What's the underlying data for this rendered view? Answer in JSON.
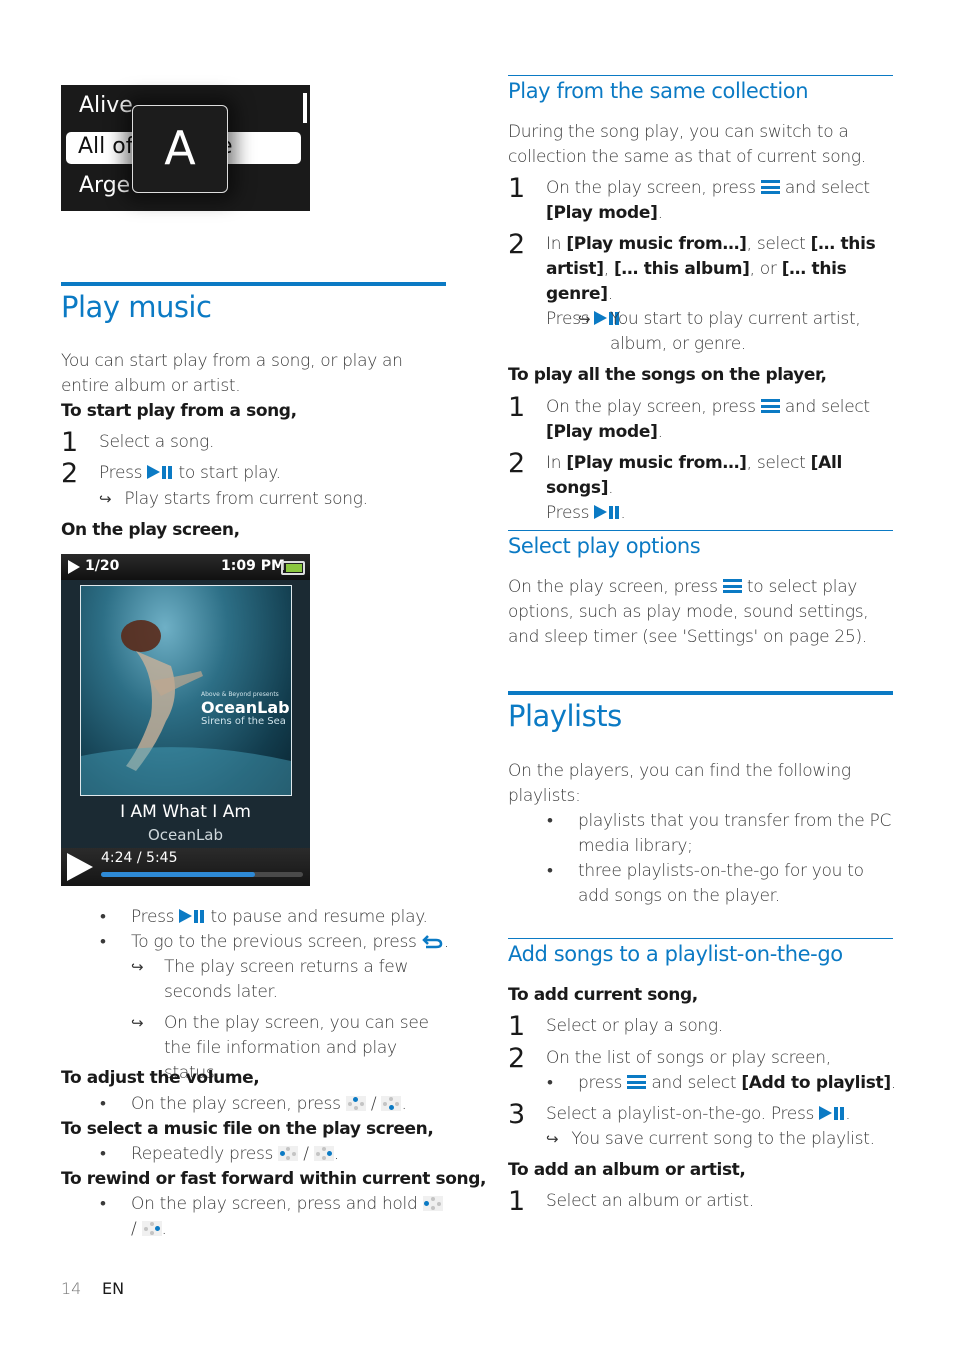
{
  "page": {
    "number": "14",
    "lang": "EN"
  },
  "colors": {
    "accent": "#0b7ac4",
    "text": "#3a3a3a",
    "heading_text": "#1a1a1a"
  },
  "list_screen": {
    "rows": [
      "Alive",
      "All of",
      "Argentina"
    ],
    "selected_row_visible": "All of",
    "selected_row_tail": "e",
    "row3_visible": "Arge",
    "letter_popup": "A"
  },
  "play_screen": {
    "track_position": "1/20",
    "time": "1:09 PM",
    "album_presenter": "Above & Beyond presents",
    "album_artist_logo": "OceanLab",
    "album_title": "Sirens of the Sea",
    "song_title": "I AM What I Am",
    "artist": "OceanLab",
    "elapsed_total": "4:24 / 5:45",
    "progress_fraction": 0.76,
    "battery_fraction": 0.9
  },
  "play_music": {
    "title": "Play music",
    "intro": "You can start play from a song, or play an entire album or artist.",
    "start_from_song_lead": "To start play from a song,",
    "steps": [
      {
        "num": "1",
        "text": "Select a song."
      },
      {
        "num": "2",
        "pre": "Press",
        "post": "to start play.",
        "result": "Play starts from current song."
      }
    ],
    "on_play_screen_lead": "On the play screen,",
    "bullets": [
      {
        "pre": "Press",
        "post": "to pause and resume play."
      },
      {
        "pre": "To go to the previous screen, press",
        "post": "."
      }
    ],
    "results": [
      "The play screen returns a few seconds later.",
      "On the play screen, you can see the file information and play status."
    ],
    "volume_lead": "To adjust the volume,",
    "volume_bullet": {
      "pre": "On the play screen, press",
      "sep": "/",
      "post": "."
    },
    "select_file_lead": "To select a music file on the play screen,",
    "select_file_bullet": {
      "pre": "Repeatedly press",
      "sep": "/",
      "post": "."
    },
    "rewind_lead": "To rewind or fast forward within current song,",
    "rewind_bullet": {
      "pre": "On the play screen, press and hold",
      "sep": "/",
      "post": "."
    }
  },
  "same_collection": {
    "title": "Play from the same collection",
    "intro": "During the song play, you can switch to a collection the same as that of current song.",
    "step1": {
      "num": "1",
      "pre": "On the play screen, press",
      "mid": "and select",
      "bold": "[Play mode]",
      "post": "."
    },
    "step2": {
      "num": "2",
      "in": "In",
      "bold1": "[Play music from…]",
      "select": ", select",
      "bold2": "[… this artist]",
      "bold3": "[… this album]",
      "or": ", or",
      "bold4": "[… this genre]",
      "press": "Press",
      "result": "You start to play current artist, album, or genre."
    },
    "all_songs_lead": "To play all the songs on the player,",
    "all_step1": {
      "num": "1",
      "pre": "On the play screen, press",
      "mid": "and select",
      "bold": "[Play mode]",
      "post": "."
    },
    "all_step2": {
      "num": "2",
      "in": "In",
      "bold1": "[Play music from…]",
      "select": ", select",
      "bold2": "[All songs]",
      "post": ".",
      "press": "Press"
    }
  },
  "play_options": {
    "title": "Select play options",
    "pre": "On the play screen, press",
    "post": "to select play options, such as play mode, sound settings, and sleep timer (see 'Settings' on page 25)."
  },
  "playlists": {
    "title": "Playlists",
    "intro": "On the players, you can find the following playlists:",
    "bullets": [
      "playlists that you transfer from the PC media library;",
      "three playlists-on-the-go for you to add songs on the player."
    ]
  },
  "add_songs": {
    "title": "Add songs to a playlist-on-the-go",
    "current_lead": "To add current song,",
    "step1": {
      "num": "1",
      "text": "Select or play a song."
    },
    "step2": {
      "num": "2",
      "text": "On the list of songs or play screen,",
      "sub_pre": "press",
      "sub_mid": "and select",
      "sub_bold": "[Add to playlist]",
      "sub_post": "."
    },
    "step3": {
      "num": "3",
      "pre": "Select a playlist-on-the-go. Press",
      "post": ".",
      "result": "You save current song to the playlist."
    },
    "album_lead": "To add an album or artist,",
    "album_step1": {
      "num": "1",
      "text": "Select an album or artist."
    }
  }
}
